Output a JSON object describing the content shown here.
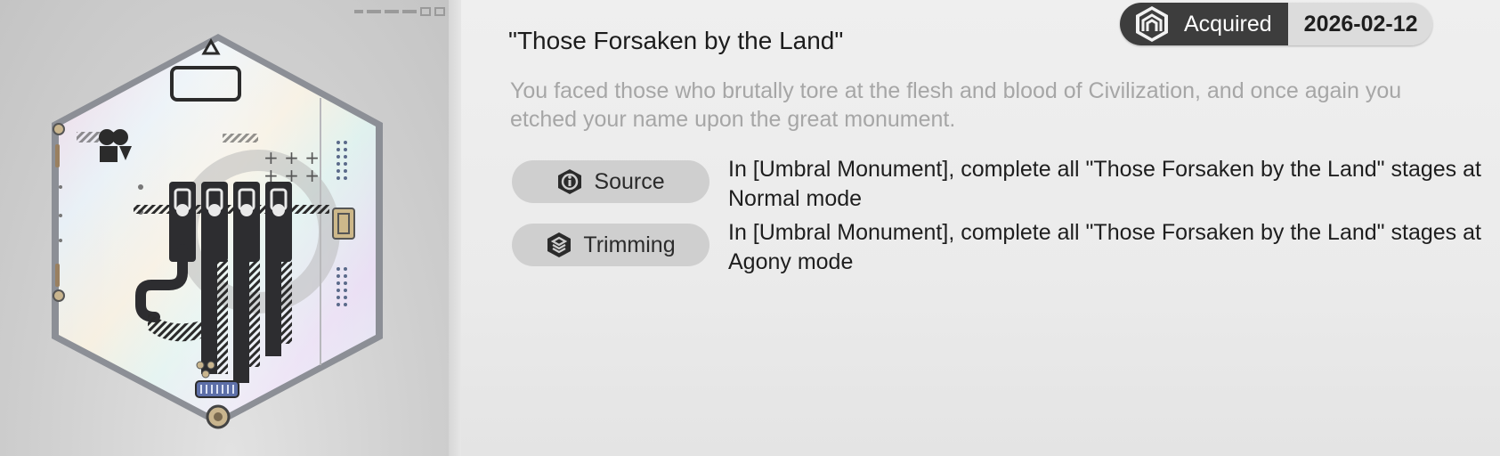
{
  "status": {
    "label": "Acquired",
    "date": "2026-02-12",
    "icon": "acquired-emblem-icon"
  },
  "achievement": {
    "title": "\"Those Forsaken by the Land\"",
    "description": "You faced those who brutally tore at the flesh and blood of Civilization, and once again you etched your name upon the great monument."
  },
  "requirements": [
    {
      "label": "Source",
      "icon": "info-hexagon-icon",
      "text": "In [Umbral Monument], complete all \"Those Forsaken by the Land\" stages at Normal mode"
    },
    {
      "label": "Trimming",
      "icon": "layers-hexagon-icon",
      "text": "In [Umbral Monument], complete all \"Those Forsaken by the Land\" stages at Agony mode"
    }
  ],
  "colors": {
    "status_dark": "#3d3d3d",
    "status_light": "#dcdcdc",
    "pill_bg": "#cfcfcf",
    "description_gray": "#a6a6a6"
  }
}
